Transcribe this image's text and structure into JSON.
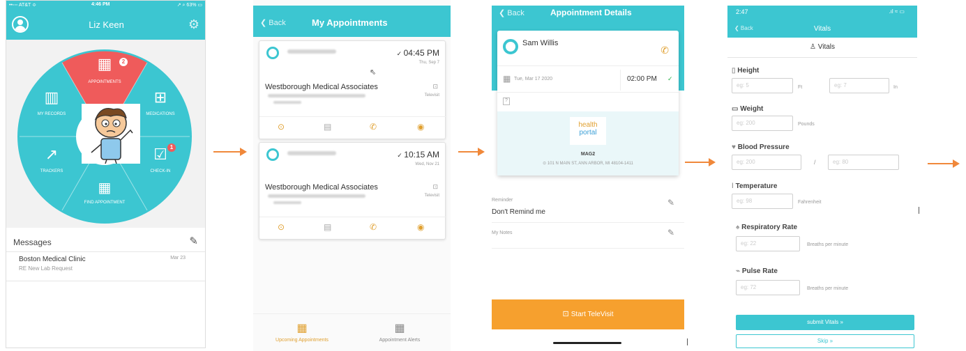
{
  "colors": {
    "teal": "#3cc6d1",
    "red": "#ef5b5b",
    "orange": "#f0883a",
    "button_orange": "#f6a02e"
  },
  "screen1": {
    "status_carrier": "••◦◦◦ AT&T ≎",
    "status_time": "4:46 PM",
    "status_right": "↗ ⌕ 63% ▭",
    "user_name": "Liz Keen",
    "badge_appt": "2",
    "badge_checkin": "1",
    "menu": {
      "appointments": "APPOINTMENTS",
      "my_records": "MY RECORDS",
      "medications": "MEDICATIONS",
      "trackers": "TRACKERS",
      "check_in": "CHECK-IN",
      "find_appointment": "FIND APPOINTMENT"
    },
    "messages_title": "Messages",
    "message": {
      "sender": "Boston Medical Clinic",
      "preview": "RE New Lab Request",
      "date": "Mar 23"
    }
  },
  "screen2": {
    "back": "❮ Back",
    "title": "My Appointments",
    "appointments": [
      {
        "time": "04:45 PM",
        "date": "Thu, Sep 7",
        "provider": "Westborough Medical Associates",
        "type": "Televisit"
      },
      {
        "time": "10:15 AM",
        "date": "Wed, Nov 21",
        "provider": "Westborough Medical Associates",
        "type": "Televisit"
      }
    ],
    "tabs": {
      "upcoming": "Upcoming Appointments",
      "alerts": "Appointment Alerts"
    }
  },
  "screen3": {
    "back": "❮ Back",
    "title": "Appointment Details",
    "doctor": "Sam Willis",
    "date": "Tue, Mar 17 2020",
    "time": "02:00 PM",
    "question": "?",
    "logo_line1": "health",
    "logo_line2": "portal",
    "location_name": "MAG2",
    "address": "101 N MAIN ST, ANN ARBOR, MI 48104-1411",
    "reminder_label": "Reminder",
    "reminder_value": "Don't Remind me",
    "notes_label": "My Notes",
    "start_button": "Start TeleVisit"
  },
  "screen4": {
    "status_time": "2:47",
    "status_right": ".ıl ≈ ▭",
    "back": "❮ Back",
    "title": "Vitals",
    "subtitle": "Vitals",
    "height": {
      "label": "Height",
      "ph1": "eg: 5",
      "unit1": "Ft",
      "ph2": "eg: 7",
      "unit2": "In"
    },
    "weight": {
      "label": "Weight",
      "ph": "eg: 200",
      "unit": "Pounds"
    },
    "bp": {
      "label": "Blood Pressure",
      "ph1": "eg: 200",
      "sep": "/",
      "ph2": "eg: 80"
    },
    "temp": {
      "label": "Temperature",
      "ph": "eg: 98",
      "unit": "Fahrenheit"
    },
    "resp": {
      "label": "Respiratory Rate",
      "ph": "eg: 22",
      "unit": "Breaths per minute"
    },
    "pulse": {
      "label": "Pulse Rate",
      "ph": "eg: 72",
      "unit": "Breaths per minute"
    },
    "submit": "submit Vitals »",
    "skip": "Skip »"
  }
}
